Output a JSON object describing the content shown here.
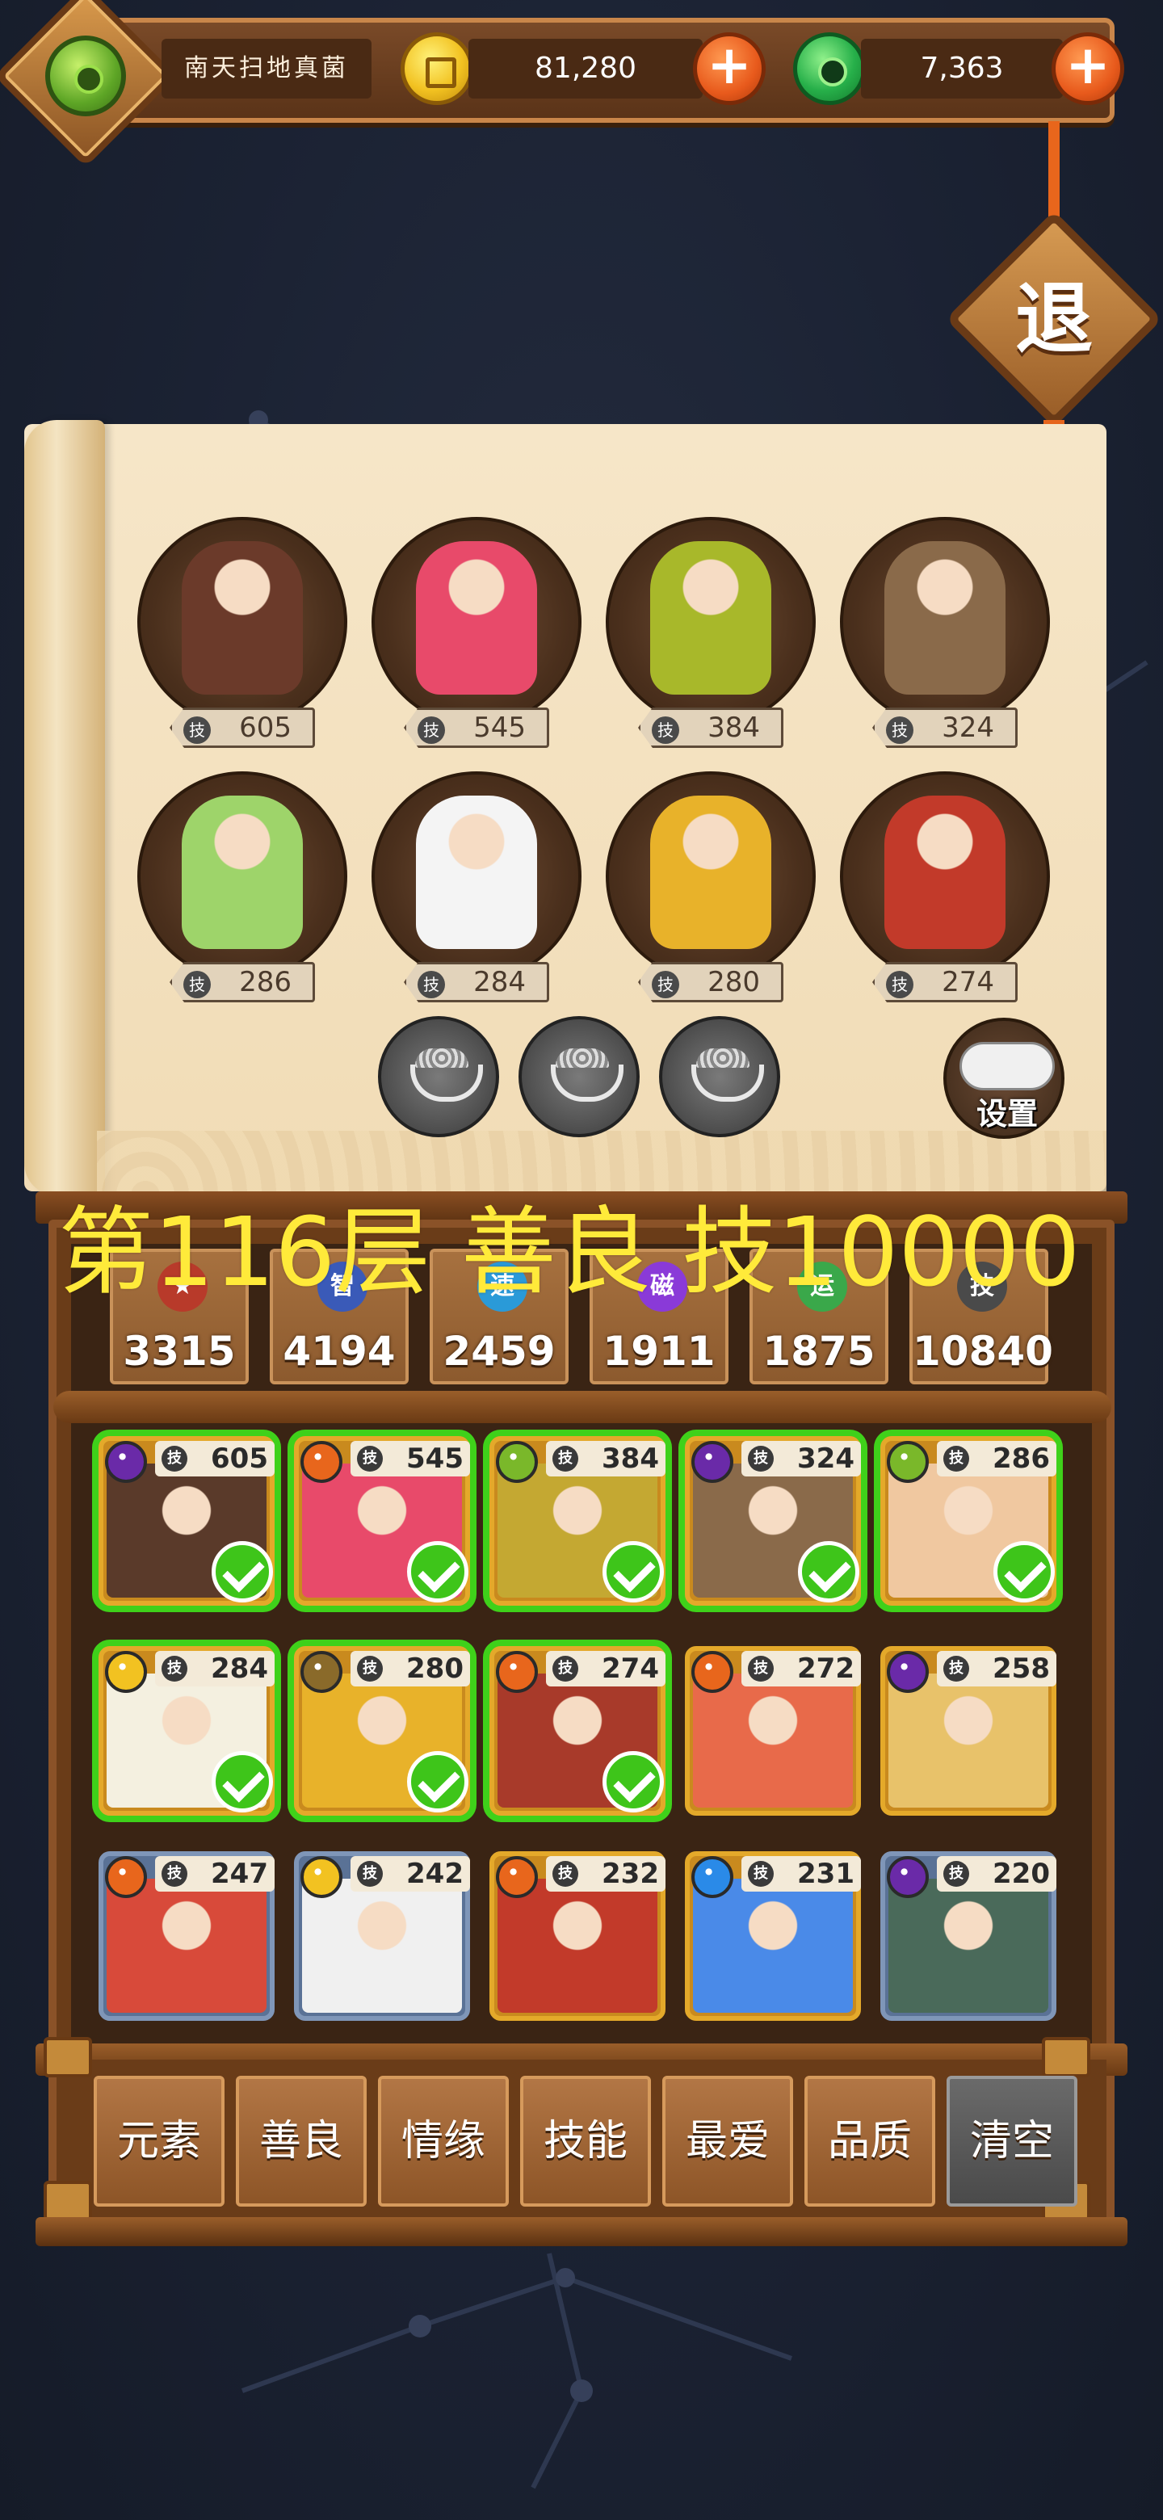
{
  "header": {
    "player_name": "南天扫地真菌",
    "coins": "81,280",
    "jade": "7,363",
    "plus_symbol": "+"
  },
  "exit_button": {
    "label": "退"
  },
  "lineup": {
    "heroes": [
      {
        "skill": "605",
        "color": "#6b3a2a"
      },
      {
        "skill": "545",
        "color": "#e84a6a"
      },
      {
        "skill": "384",
        "color": "#a8b82a"
      },
      {
        "skill": "324",
        "color": "#8a6a4a"
      },
      {
        "skill": "286",
        "color": "#9ed46a"
      },
      {
        "skill": "284",
        "color": "#f4f4f4"
      },
      {
        "skill": "280",
        "color": "#e8b22a"
      },
      {
        "skill": "274",
        "color": "#c23a2a"
      }
    ],
    "skill_icon_text": "技",
    "empty_slots": 3,
    "settings_label": "设置"
  },
  "floor_overlay": "第116层 善良 技10000",
  "stats": [
    {
      "icon": "★",
      "value": "3315",
      "color": "#b83a2a"
    },
    {
      "icon": "智",
      "value": "4194",
      "color": "#3a5ab8"
    },
    {
      "icon": "速",
      "value": "2459",
      "color": "#2a9ad8"
    },
    {
      "icon": "磁",
      "value": "1911",
      "color": "#8a3ad8"
    },
    {
      "icon": "运",
      "value": "1875",
      "color": "#3aa84a"
    },
    {
      "icon": "技",
      "value": "10840",
      "color": "#4a4a4a"
    }
  ],
  "cards": [
    {
      "skill": "605",
      "element": "#6a2aa8",
      "art": "#5a3a2a",
      "owned": true,
      "frame": "gold"
    },
    {
      "skill": "545",
      "element": "#e8661c",
      "art": "#e84a6a",
      "owned": true,
      "frame": "gold"
    },
    {
      "skill": "384",
      "element": "#7ab82a",
      "art": "#c4a832",
      "owned": true,
      "frame": "gold"
    },
    {
      "skill": "324",
      "element": "#6a2aa8",
      "art": "#8a6a4a",
      "owned": true,
      "frame": "gold"
    },
    {
      "skill": "286",
      "element": "#7ab82a",
      "art": "#f0c8a0",
      "owned": true,
      "frame": "gold"
    },
    {
      "skill": "284",
      "element": "#f2c221",
      "art": "#f4f0e0",
      "owned": true,
      "frame": "gold"
    },
    {
      "skill": "280",
      "element": "#8a6a2a",
      "art": "#e8b22a",
      "owned": true,
      "frame": "gold"
    },
    {
      "skill": "274",
      "element": "#e8661c",
      "art": "#a83a2a",
      "owned": true,
      "frame": "gold"
    },
    {
      "skill": "272",
      "element": "#e8661c",
      "art": "#e86a4a",
      "owned": false,
      "frame": "gold"
    },
    {
      "skill": "258",
      "element": "#6a2aa8",
      "art": "#e8c26a",
      "owned": false,
      "frame": "gold"
    },
    {
      "skill": "247",
      "element": "#e8661c",
      "art": "#d84a3a",
      "owned": false,
      "frame": "blue"
    },
    {
      "skill": "242",
      "element": "#f2c221",
      "art": "#f0f0f0",
      "owned": false,
      "frame": "blue"
    },
    {
      "skill": "232",
      "element": "#e8661c",
      "art": "#c23a2a",
      "owned": false,
      "frame": "gold"
    },
    {
      "skill": "231",
      "element": "#2a8ae8",
      "art": "#4a8ae8",
      "owned": false,
      "frame": "gold"
    },
    {
      "skill": "220",
      "element": "#6a2aa8",
      "art": "#4a6a5a",
      "owned": false,
      "frame": "blue"
    }
  ],
  "filters": [
    "元素",
    "善良",
    "情缘",
    "技能",
    "最爱",
    "品质"
  ],
  "clear_label": "清空"
}
